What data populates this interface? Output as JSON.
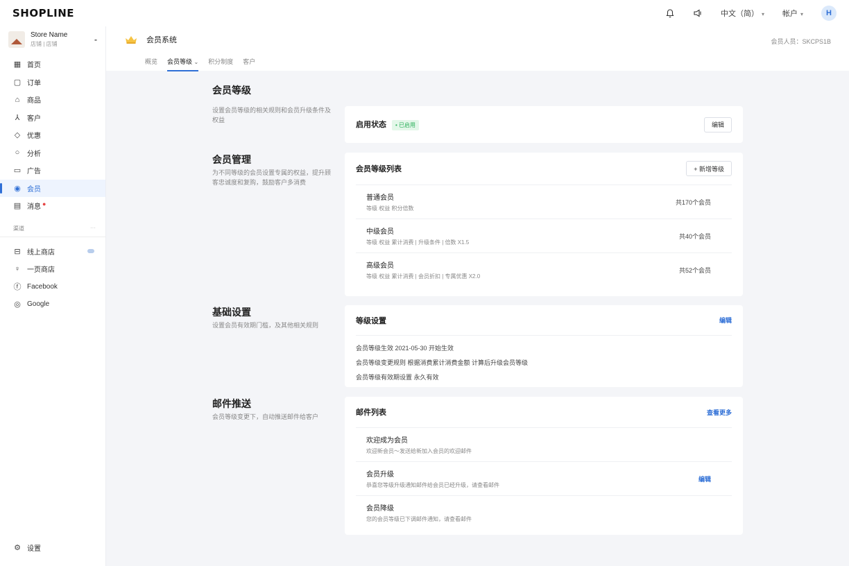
{
  "topbar": {
    "logo": "SHOPLINE",
    "language": "中文（简）",
    "account": "帐户",
    "avatar_letter": "H"
  },
  "store": {
    "name": "Store Name",
    "sub": "店铺 | 店铺"
  },
  "sidebar": {
    "items": [
      {
        "icon": "home-icon",
        "label": "首页"
      },
      {
        "icon": "orders-icon",
        "label": "订单"
      },
      {
        "icon": "products-icon",
        "label": "商品"
      },
      {
        "icon": "customers-icon",
        "label": "客户"
      },
      {
        "icon": "marketing-icon",
        "label": "优惠"
      },
      {
        "icon": "analytics-icon",
        "label": "分析"
      },
      {
        "icon": "ads-icon",
        "label": "广告"
      },
      {
        "icon": "member-icon",
        "label": "会员",
        "active": true
      },
      {
        "icon": "message-icon",
        "label": "消息",
        "dot": true
      }
    ],
    "section_label": "渠道",
    "section_more": "···",
    "channels": [
      {
        "icon": "store-icon",
        "label": "线上商店"
      },
      {
        "icon": "pos-icon",
        "label": "一页商店"
      },
      {
        "icon": "facebook-icon",
        "label": "Facebook"
      },
      {
        "icon": "google-icon",
        "label": "Google"
      }
    ],
    "settings_label": "设置"
  },
  "subheader": {
    "title": "会员系统",
    "right": "会员人员：SKCPS1B",
    "tabs": [
      "概览",
      "会员等级",
      "积分制度",
      "客户"
    ]
  },
  "sections": {
    "levels": {
      "title": "会员等级",
      "desc": "设置会员等级的相关规则和会员升级条件及权益"
    },
    "status_card": {
      "label": "启用状态",
      "badge": "• 已启用",
      "button": "编辑"
    },
    "management": {
      "title": "会员管理",
      "desc": "为不同等级的会员设置专属的权益，提升顾客忠诚度和复购，鼓励客户多消费"
    },
    "levels_card": {
      "title": "会员等级列表",
      "add_button": "+ 新增等级",
      "rows": [
        {
          "name": "普通会员",
          "sub": "等级 权益 积分倍数",
          "count": "共170个会员"
        },
        {
          "name": "中级会员",
          "sub": "等级 权益 累计消费 | 升级条件 | 倍数 X1.5",
          "count": "共40个会员"
        },
        {
          "name": "高级会员",
          "sub": "等级 权益 累计消费 | 会员折扣 | 专属优惠 X2.0",
          "count": "共52个会员"
        }
      ]
    },
    "basic": {
      "title": "基础设置",
      "desc": "设置会员有效期门槛，及其他相关规则"
    },
    "basic_card": {
      "title": "等级设置",
      "link": "编辑",
      "lines": [
        "会员等级生效 2021-05-30 开始生效",
        "会员等级变更规则 根据消费累计消费金额 计算后升级会员等级",
        "会员等级有效期设置 永久有效"
      ]
    },
    "email": {
      "title": "邮件推送",
      "desc": "会员等级变更下，自动推送邮件给客户"
    },
    "email_card": {
      "title": "邮件列表",
      "link": "查看更多",
      "rows": [
        {
          "name": "欢迎成为会员",
          "sub": "欢迎新会员～发送给新加入会员的欢迎邮件",
          "action": ""
        },
        {
          "name": "会员升级",
          "sub": "恭喜您等级升级通知邮件给会员已经升级，请查看邮件",
          "action": "编辑"
        },
        {
          "name": "会员降级",
          "sub": "您的会员等级已下调邮件通知，请查看邮件",
          "action": ""
        }
      ]
    }
  }
}
